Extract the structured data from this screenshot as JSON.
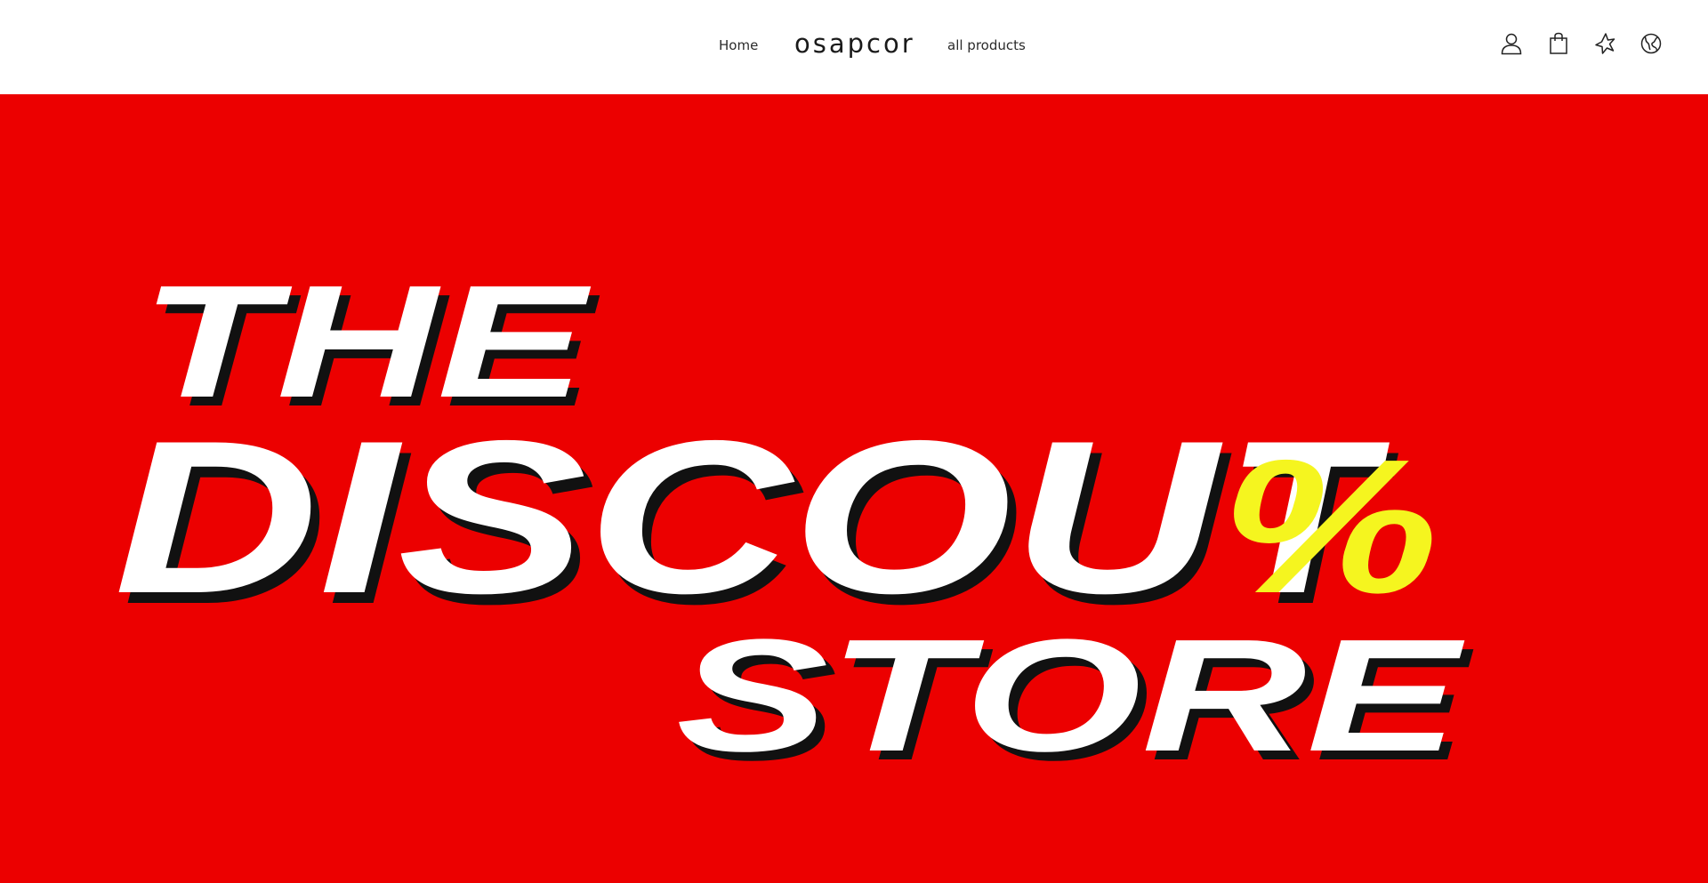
{
  "header": {
    "brand": "osapcor",
    "nav": [
      {
        "label": "Home"
      },
      {
        "label": "all products"
      }
    ],
    "icons": [
      "user-icon",
      "shopping-bag-icon",
      "wishlist-icon",
      "globe-icon"
    ]
  },
  "hero": {
    "background_color": "#ec0000",
    "logo": {
      "line1": "THE",
      "line2_part1": "DISCOU",
      "line2_symbol": "%",
      "line2_part2": "T",
      "line3": "STORE",
      "text_color": "#ffffff",
      "shadow_color": "#111111",
      "accent_color": "#f5f51f"
    }
  }
}
